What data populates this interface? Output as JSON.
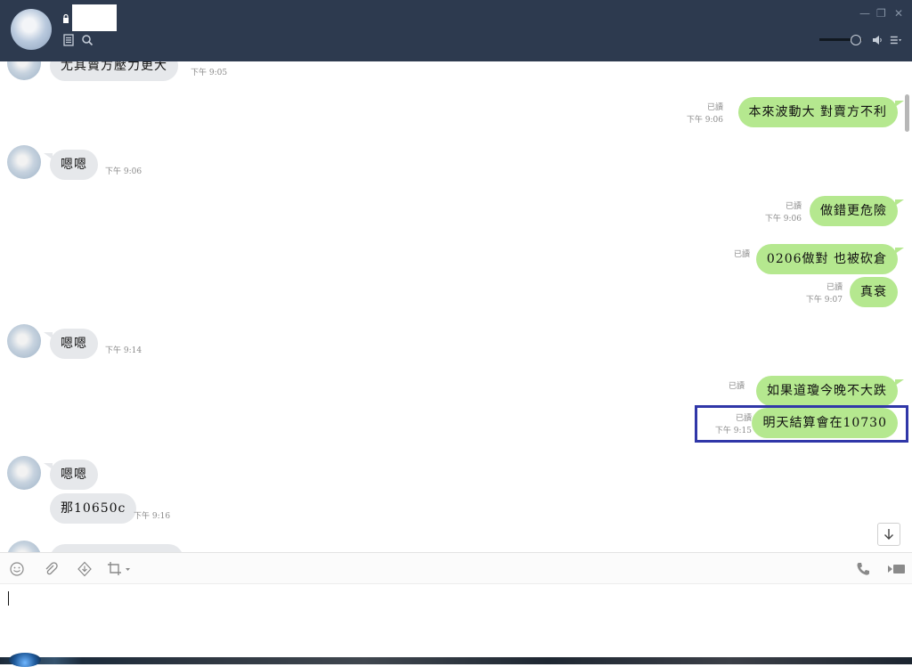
{
  "window": {
    "contact_name": "",
    "controls": [
      "minimize-icon",
      "restore-icon",
      "close-icon"
    ],
    "volume_level": 0.85
  },
  "messages": {
    "m0": {
      "text": "尤其賣方壓力更大",
      "time": "下午 9:05"
    },
    "m1": {
      "text": "本來波動大 對賣方不利",
      "read": "已讀",
      "time": "下午 9:06"
    },
    "m2": {
      "text": "嗯嗯",
      "time": "下午 9:06"
    },
    "m3": {
      "text": "做錯更危險",
      "read": "已讀",
      "time": "下午 9:06"
    },
    "m4": {
      "text": "0206做對 也被砍倉",
      "read": "已讀"
    },
    "m5": {
      "text": "真衰",
      "read": "已讀",
      "time": "下午 9:07"
    },
    "m6": {
      "text": "嗯嗯",
      "time": "下午 9:14"
    },
    "m7": {
      "text": "如果道瓊今晚不大跌",
      "read": "已讀"
    },
    "m8": {
      "text": "明天結算會在10730",
      "read": "已讀",
      "time": "下午 9:15"
    },
    "m9": {
      "text": "嗯嗯"
    },
    "m10": {
      "text": "那10650c",
      "time": "下午 9:16"
    }
  },
  "colors": {
    "titlebar": "#2d3a4f",
    "outgoing_bubble": "#b5e88f",
    "incoming_bubble": "#e6e8eb",
    "highlight": "#3037a8"
  },
  "icons": {
    "toolbar": [
      "emoji-icon",
      "attachment-icon",
      "download-icon",
      "crop-screenshot-icon",
      "phone-icon",
      "video-icon"
    ],
    "header": [
      "lock-icon",
      "notes-icon",
      "search-icon",
      "speaker-icon",
      "menu-icon"
    ]
  }
}
